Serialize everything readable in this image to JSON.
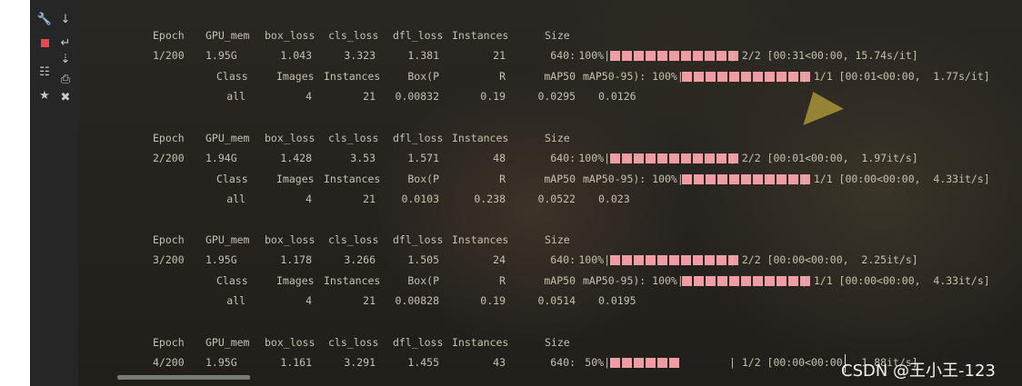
{
  "toolbar": {
    "col1": [
      "wrench-icon",
      "stop-icon",
      "layout-icon",
      "pin-icon"
    ],
    "col2": [
      "arrow-down-icon",
      "soft-wrap-icon",
      "sort-icon",
      "print-icon",
      "trash-icon"
    ],
    "stop_color": "#e34b4b"
  },
  "epochs": [
    {
      "header": {
        "epoch": "Epoch",
        "gpu": "GPU_mem",
        "box": "box_loss",
        "cls": "cls_loss",
        "dfl": "dfl_loss",
        "inst": "Instances",
        "size": "Size"
      },
      "train": {
        "epoch": "1/200",
        "gpu": "1.95G",
        "box": "1.043",
        "cls": "3.323",
        "dfl": "1.381",
        "inst": "21",
        "size": "640:",
        "pct": "100%|",
        "progress": 1.0,
        "tail": "| 2/2 [00:31<00:00, 15.74s/it]"
      },
      "val_header": {
        "cls": "Class",
        "img": "Images",
        "inst": "Instances",
        "boxp": "Box(P",
        "r": "R",
        "map50": "mAP50",
        "map5095": "mAP50-95): 100%|",
        "progress": 1.0,
        "tail": "| 1/1 [00:01<00:00,  1.77s/it]"
      },
      "val": {
        "cls": "all",
        "img": "4",
        "inst": "21",
        "p": "0.00832",
        "r": "0.19",
        "map50": "0.0295",
        "map5095": "0.0126"
      }
    },
    {
      "header": {
        "epoch": "Epoch",
        "gpu": "GPU_mem",
        "box": "box_loss",
        "cls": "cls_loss",
        "dfl": "dfl_loss",
        "inst": "Instances",
        "size": "Size"
      },
      "train": {
        "epoch": "2/200",
        "gpu": "1.94G",
        "box": "1.428",
        "cls": "3.53",
        "dfl": "1.571",
        "inst": "48",
        "size": "640:",
        "pct": "100%|",
        "progress": 1.0,
        "tail": "| 2/2 [00:01<00:00,  1.97it/s]"
      },
      "val_header": {
        "cls": "Class",
        "img": "Images",
        "inst": "Instances",
        "boxp": "Box(P",
        "r": "R",
        "map50": "mAP50",
        "map5095": "mAP50-95): 100%|",
        "progress": 1.0,
        "tail": "| 1/1 [00:00<00:00,  4.33it/s]"
      },
      "val": {
        "cls": "all",
        "img": "4",
        "inst": "21",
        "p": "0.0103",
        "r": "0.238",
        "map50": "0.0522",
        "map5095": "0.023"
      }
    },
    {
      "header": {
        "epoch": "Epoch",
        "gpu": "GPU_mem",
        "box": "box_loss",
        "cls": "cls_loss",
        "dfl": "dfl_loss",
        "inst": "Instances",
        "size": "Size"
      },
      "train": {
        "epoch": "3/200",
        "gpu": "1.95G",
        "box": "1.178",
        "cls": "3.266",
        "dfl": "1.505",
        "inst": "24",
        "size": "640:",
        "pct": "100%|",
        "progress": 1.0,
        "tail": "| 2/2 [00:00<00:00,  2.25it/s]"
      },
      "val_header": {
        "cls": "Class",
        "img": "Images",
        "inst": "Instances",
        "boxp": "Box(P",
        "r": "R",
        "map50": "mAP50",
        "map5095": "mAP50-95): 100%|",
        "progress": 1.0,
        "tail": "| 1/1 [00:00<00:00,  4.33it/s]"
      },
      "val": {
        "cls": "all",
        "img": "4",
        "inst": "21",
        "p": "0.00828",
        "r": "0.19",
        "map50": "0.0514",
        "map5095": "0.0195"
      }
    },
    {
      "header": {
        "epoch": "Epoch",
        "gpu": "GPU_mem",
        "box": "box_loss",
        "cls": "cls_loss",
        "dfl": "dfl_loss",
        "inst": "Instances",
        "size": "Size"
      },
      "train": {
        "epoch": "4/200",
        "gpu": "1.95G",
        "box": "1.161",
        "cls": "3.291",
        "dfl": "1.455",
        "inst": "43",
        "size": "640:",
        "pct": "50%|",
        "progress": 0.5,
        "tail": "| 1/2 [00:00<00:00,  1.88it/s]"
      }
    }
  ],
  "watermark": "CSDN @王小王-123",
  "colors": {
    "text": "#c7c0b0",
    "bar": "#f09ca4",
    "background": "#1d1b18"
  }
}
